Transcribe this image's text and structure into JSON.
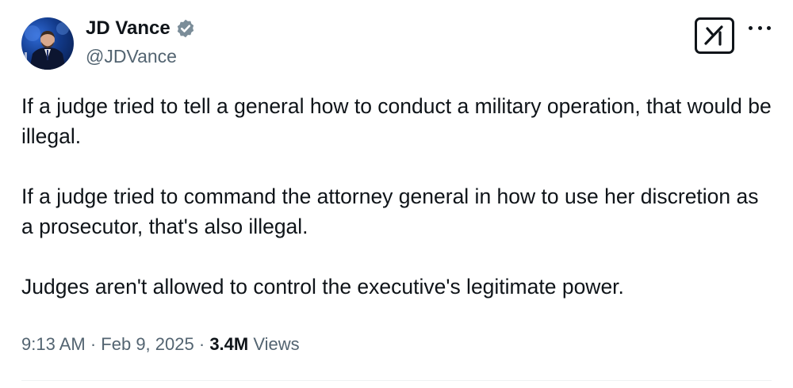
{
  "author": {
    "display_name": "JD Vance",
    "handle": "@JDVance",
    "verified": true,
    "verified_color": "#7b8d99",
    "avatar_icon": "profile-photo"
  },
  "toolbar": {
    "logo_icon": "x-grok-logo-icon",
    "more_icon": "more-options-icon"
  },
  "tweet": {
    "paragraphs": [
      "If a judge tried to tell a general how to conduct a military operation, that would be illegal.",
      "If a judge tried to command the attorney general in how to use her discretion as a prosecutor, that's also illegal.",
      "Judges aren't allowed to control the executive's legitimate power."
    ]
  },
  "meta": {
    "time": "9:13 AM",
    "separator": "·",
    "date": "Feb 9, 2025",
    "views_count": "3.4M",
    "views_label": "Views"
  },
  "colors": {
    "text": "#0f1419",
    "secondary": "#536471",
    "divider": "#eff3f4"
  }
}
